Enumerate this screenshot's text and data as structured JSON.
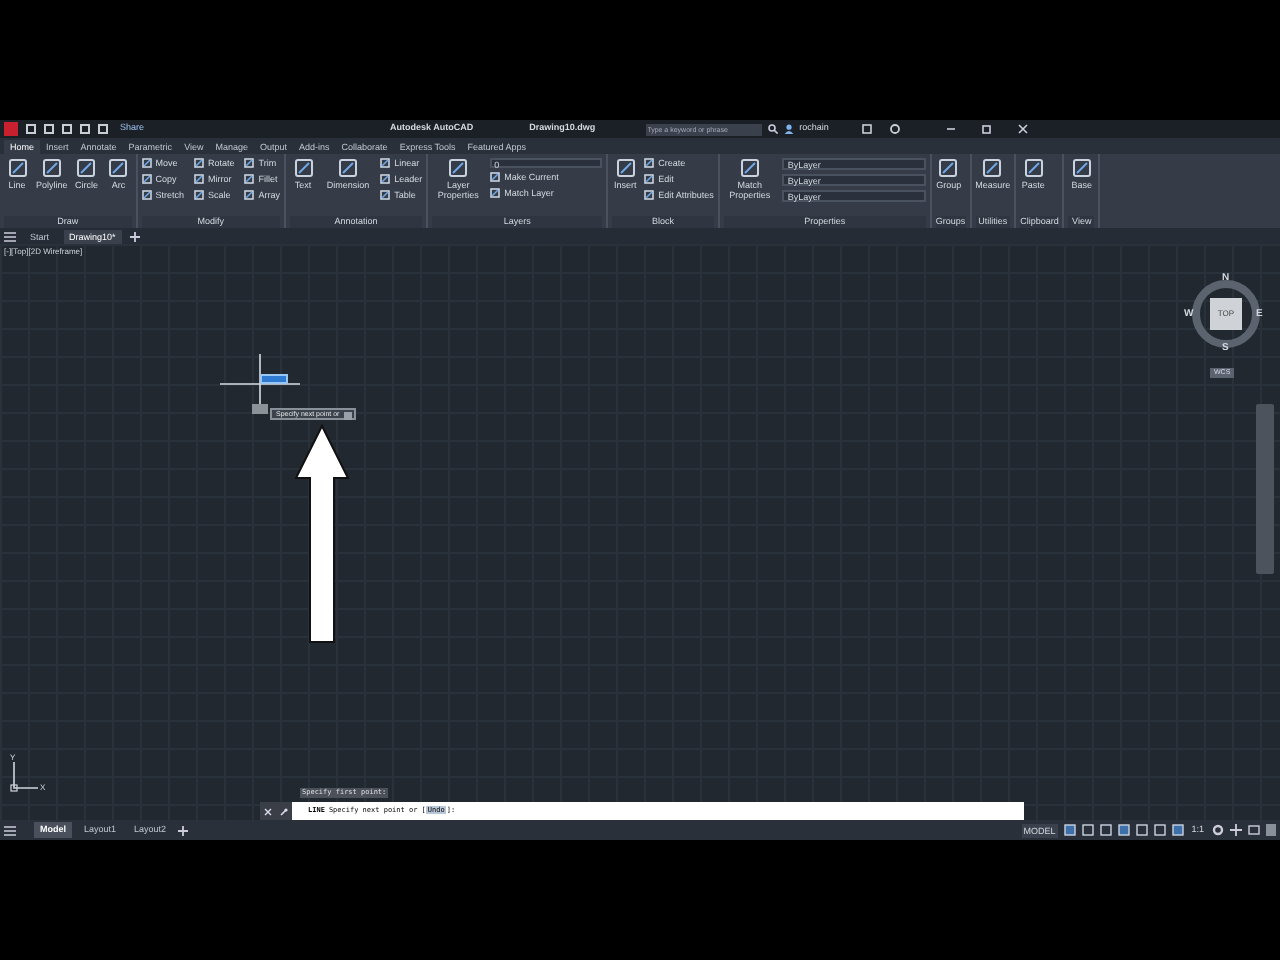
{
  "title_bar": {
    "share": "Share",
    "app_title": "Autodesk AutoCAD",
    "document_title": "Drawing10.dwg",
    "search": {
      "placeholder": "Type a keyword or phrase"
    },
    "user": "rochain"
  },
  "ribbon_tabs": [
    {
      "label": "Home",
      "selected": true
    },
    {
      "label": "Insert",
      "selected": false
    },
    {
      "label": "Annotate",
      "selected": false
    },
    {
      "label": "Parametric",
      "selected": false
    },
    {
      "label": "View",
      "selected": false
    },
    {
      "label": "Manage",
      "selected": false
    },
    {
      "label": "Output",
      "selected": false
    },
    {
      "label": "Add-ins",
      "selected": false
    },
    {
      "label": "Collaborate",
      "selected": false
    },
    {
      "label": "Express Tools",
      "selected": false
    },
    {
      "label": "Featured Apps",
      "selected": false
    }
  ],
  "panels": [
    {
      "title": "Draw",
      "large_tools": [
        "Line",
        "Polyline",
        "Circle",
        "Arc"
      ]
    },
    {
      "title": "Modify",
      "small_tools": [
        "Move",
        "Copy",
        "Stretch",
        "Rotate",
        "Mirror",
        "Scale",
        "Trim",
        "Fillet",
        "Array"
      ]
    },
    {
      "title": "Annotation",
      "large_tools": [
        "Text",
        "Dimension"
      ],
      "small_tools": [
        "Linear",
        "Leader",
        "Table"
      ]
    },
    {
      "title": "Layers",
      "large_tools": [
        "Layer Properties"
      ],
      "layer_dropdown": "0",
      "small_tools": [
        "Make Current",
        "Match Layer"
      ]
    },
    {
      "title": "Block",
      "large_tools": [
        "Insert"
      ],
      "small_tools": [
        "Create",
        "Edit",
        "Edit Attributes"
      ]
    },
    {
      "title": "Properties",
      "large_tools": [
        "Match Properties"
      ],
      "dropdowns": [
        "ByLayer",
        "ByLayer",
        "ByLayer"
      ]
    },
    {
      "title": "Groups",
      "large_tools": [
        "Group"
      ]
    },
    {
      "title": "Utilities",
      "large_tools": [
        "Measure"
      ]
    },
    {
      "title": "Clipboard",
      "large_tools": [
        "Paste"
      ]
    },
    {
      "title": "View",
      "large_tools": [
        "Base"
      ]
    }
  ],
  "file_tabs": [
    {
      "label": "Start",
      "selected": false
    },
    {
      "label": "Drawing10*",
      "selected": true
    }
  ],
  "viewport": {
    "label": "[-][Top][2D Wireframe]",
    "viewcube": {
      "north": "N",
      "south": "S",
      "east": "E",
      "west": "W",
      "face": "TOP",
      "ucs": "WCS"
    },
    "cursor_tooltip": "Specify next point or",
    "ucs_axes": {
      "x": "X",
      "y": "Y"
    }
  },
  "command_line": {
    "history": "Specify first point:",
    "command": "LINE",
    "prompt": "Specify next point or [",
    "option": "Undo",
    "prompt_end": "]:"
  },
  "layout_tabs": [
    {
      "label": "Model",
      "selected": true
    },
    {
      "label": "Layout1",
      "selected": false
    },
    {
      "label": "Layout2",
      "selected": false
    }
  ],
  "status_bar": {
    "space": "MODEL",
    "scale": "1:1"
  }
}
